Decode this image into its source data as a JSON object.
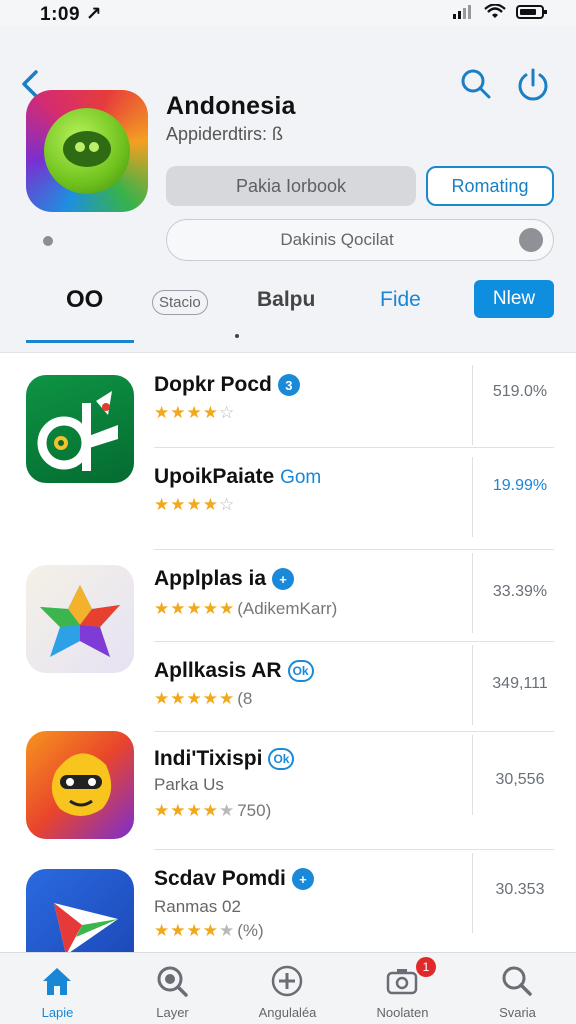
{
  "status": {
    "time": "1:09 ↗"
  },
  "app": {
    "title": "Andonesia",
    "subtitle": "Appiderdtirs: ß",
    "primary_button": "Pakia Iorbook",
    "secondary_button": "Romating",
    "search_placeholder": "Dakinis Qocilat"
  },
  "tabs": {
    "items": [
      "OO",
      "Stacio",
      "Balpu",
      "Fide",
      "Nlew"
    ]
  },
  "apps": [
    {
      "name": "Dopkr Pocd",
      "badge": "3",
      "rating": "★★★★",
      "rating_gray": "☆",
      "note": "",
      "price": "519.0%",
      "price_style": "gray"
    },
    {
      "name": "UpoikPaiate",
      "name_tail": "Gom",
      "rating": "★★★★",
      "rating_gray": "☆",
      "note": "",
      "price": "19.99%",
      "price_style": "blue"
    },
    {
      "name": "Applplas ia",
      "badge": "+",
      "rating": "★★★★★",
      "rating_gray": "",
      "note": "(AdikemKarr)",
      "price": "33.39%",
      "price_style": "gray"
    },
    {
      "name": "Apllkasis AR",
      "badge": "Ok",
      "rating": "★★★★★",
      "rating_gray": "",
      "note": "(8",
      "price": "349,111",
      "price_style": "gray"
    },
    {
      "name": "Indi'Tixispi",
      "badge": "Ok",
      "sub": "Parka Us",
      "rating": "★★★★",
      "rating_gray": "★",
      "note": "750)",
      "price": "30,556",
      "price_style": "gray"
    },
    {
      "name": "Scdav Pomdi",
      "badge": "+",
      "sub": "Ranmas 02",
      "rating": "★★★★",
      "rating_gray": "★",
      "note": "(%)",
      "price": "30.353",
      "price_style": "gray"
    }
  ],
  "tabbar": {
    "items": [
      "Lapie",
      "Layer",
      "Angulaléa",
      "Noolaten",
      "Svaria"
    ],
    "notification_count": "1",
    "active_color": "#1a86d6"
  }
}
